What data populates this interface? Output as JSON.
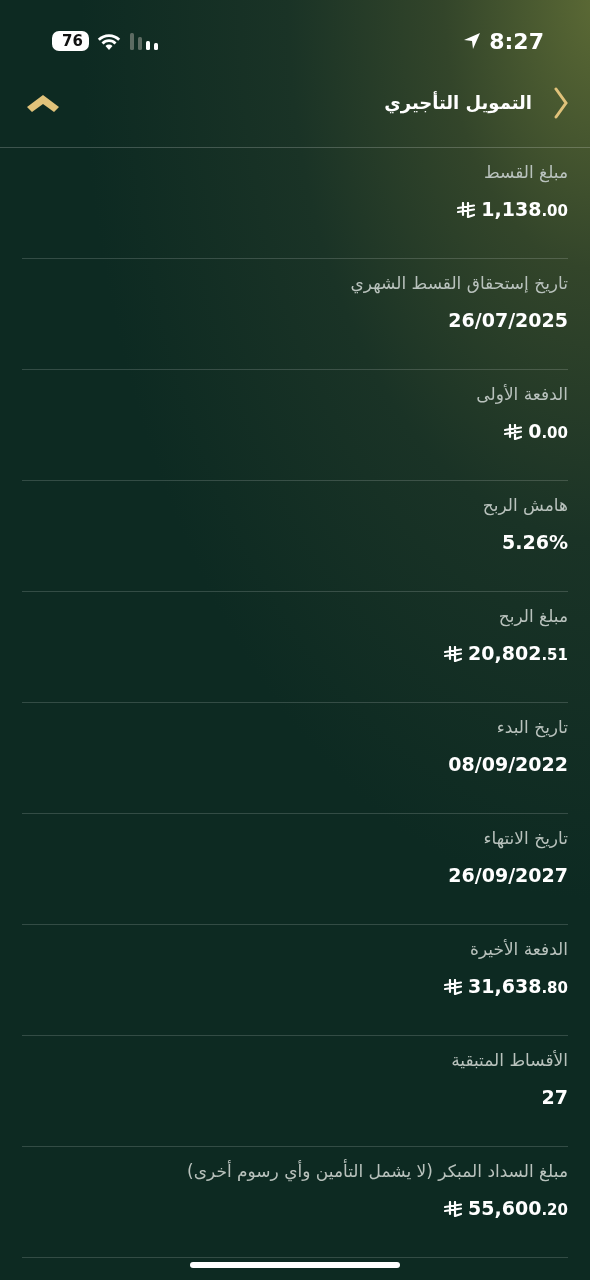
{
  "status_bar": {
    "time": "8:27",
    "battery": "76"
  },
  "header": {
    "title": "التمويل التأجيري"
  },
  "rows": [
    {
      "label": "مبلغ القسط",
      "kind": "money",
      "integer": "1,138",
      "decimals": ".00"
    },
    {
      "label": "تاريخ إستحقاق القسط الشهري",
      "kind": "text",
      "value": "26/07/2025"
    },
    {
      "label": "الدفعة الأولى",
      "kind": "money",
      "integer": "0",
      "decimals": ".00"
    },
    {
      "label": "هامش الربح",
      "kind": "text",
      "value": "5.26%"
    },
    {
      "label": "مبلغ الربح",
      "kind": "money",
      "integer": "20,802",
      "decimals": ".51"
    },
    {
      "label": "تاريخ البدء",
      "kind": "text",
      "value": "08/09/2022"
    },
    {
      "label": "تاريخ الانتهاء",
      "kind": "text",
      "value": "26/09/2027"
    },
    {
      "label": "الدفعة الأخيرة",
      "kind": "money",
      "integer": "31,638",
      "decimals": ".80"
    },
    {
      "label": "الأقساط المتبقية",
      "kind": "text",
      "value": "27"
    },
    {
      "label": "مبلغ السداد المبكر (لا يشمل التأمين وأي رسوم أخرى)",
      "kind": "money",
      "integer": "55,600",
      "decimals": ".20"
    }
  ]
}
